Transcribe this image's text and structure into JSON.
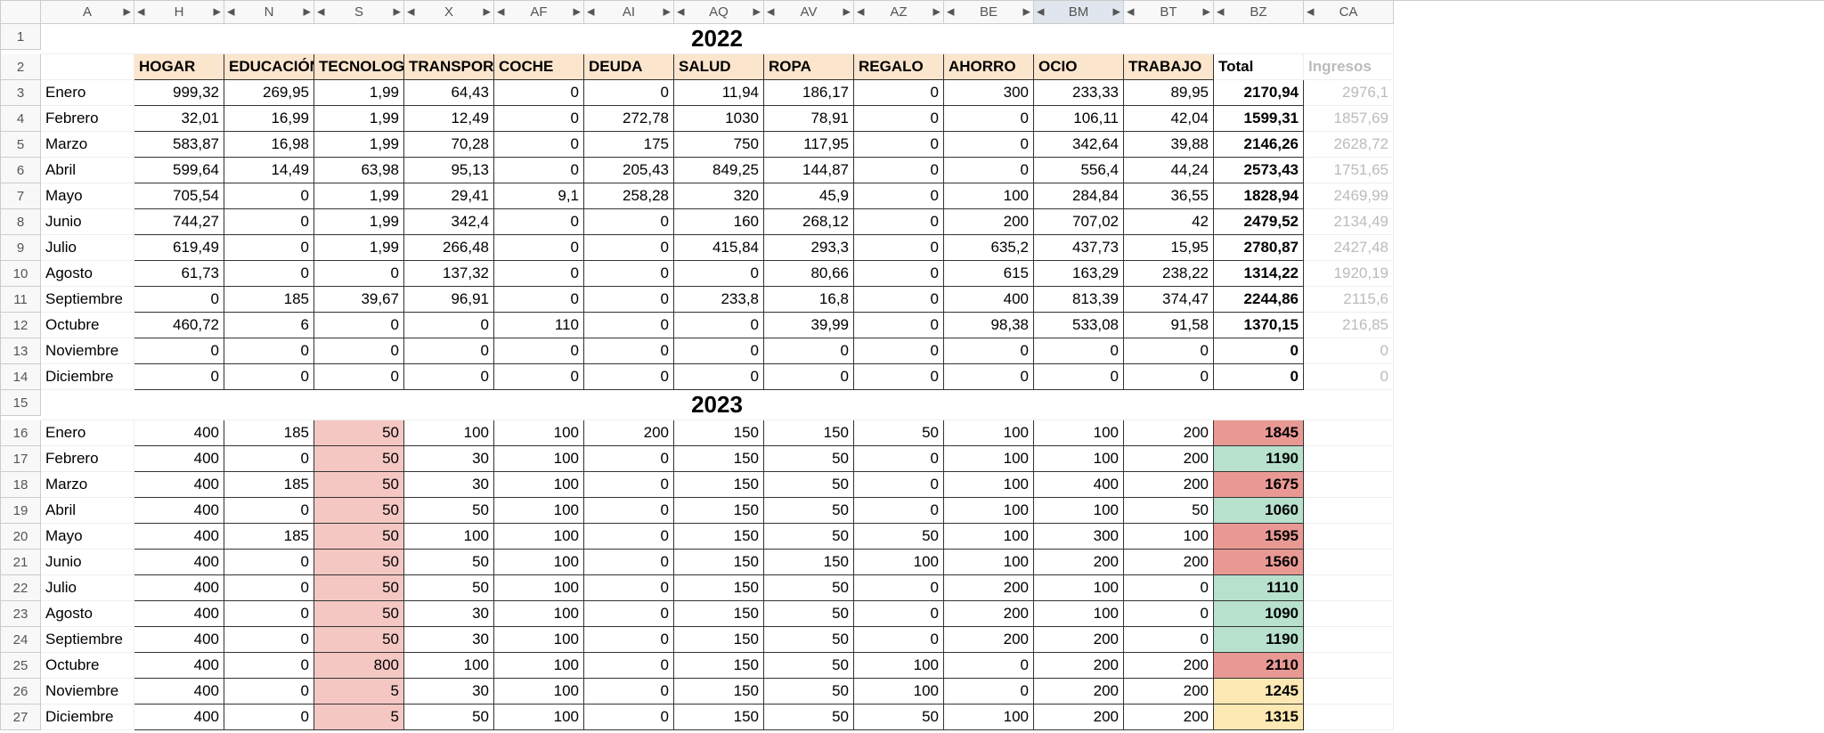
{
  "columns": [
    "A",
    "H",
    "N",
    "S",
    "X",
    "AF",
    "AI",
    "AQ",
    "AV",
    "AZ",
    "BE",
    "BM",
    "BT",
    "BZ",
    "CA"
  ],
  "selected_col": "BM",
  "row_numbers": [
    "1",
    "2",
    "3",
    "4",
    "5",
    "6",
    "7",
    "8",
    "9",
    "10",
    "11",
    "12",
    "13",
    "14",
    "15",
    "16",
    "17",
    "18",
    "19",
    "20",
    "21",
    "22",
    "23",
    "24",
    "25",
    "26",
    "27"
  ],
  "year_2022": "2022",
  "year_2023": "2023",
  "headers": {
    "hogar": "HOGAR",
    "educacion": "EDUCACIÓN",
    "tecnologia": "TECNOLOGÍA",
    "transporte": "TRANSPORTE",
    "coche": "COCHE",
    "deuda": "DEUDA",
    "salud": "SALUD",
    "ropa": "ROPA",
    "regalo": "REGALO",
    "ahorro": "AHORRO",
    "ocio": "OCIO",
    "trabajo": "TRABAJO",
    "total": "Total",
    "ingresos": "Ingresos"
  },
  "data2022": [
    {
      "m": "Enero",
      "v": [
        "999,32",
        "269,95",
        "1,99",
        "64,43",
        "0",
        "0",
        "11,94",
        "186,17",
        "0",
        "300",
        "233,33",
        "89,95"
      ],
      "t": "2170,94",
      "i": "2976,1"
    },
    {
      "m": "Febrero",
      "v": [
        "32,01",
        "16,99",
        "1,99",
        "12,49",
        "0",
        "272,78",
        "1030",
        "78,91",
        "0",
        "0",
        "106,11",
        "42,04"
      ],
      "t": "1599,31",
      "i": "1857,69"
    },
    {
      "m": "Marzo",
      "v": [
        "583,87",
        "16,98",
        "1,99",
        "70,28",
        "0",
        "175",
        "750",
        "117,95",
        "0",
        "0",
        "342,64",
        "39,88"
      ],
      "t": "2146,26",
      "i": "2628,72"
    },
    {
      "m": "Abril",
      "v": [
        "599,64",
        "14,49",
        "63,98",
        "95,13",
        "0",
        "205,43",
        "849,25",
        "144,87",
        "0",
        "0",
        "556,4",
        "44,24"
      ],
      "t": "2573,43",
      "i": "1751,65"
    },
    {
      "m": "Mayo",
      "v": [
        "705,54",
        "0",
        "1,99",
        "29,41",
        "9,1",
        "258,28",
        "320",
        "45,9",
        "0",
        "100",
        "284,84",
        "36,55"
      ],
      "t": "1828,94",
      "i": "2469,99"
    },
    {
      "m": "Junio",
      "v": [
        "744,27",
        "0",
        "1,99",
        "342,4",
        "0",
        "0",
        "160",
        "268,12",
        "0",
        "200",
        "707,02",
        "42"
      ],
      "t": "2479,52",
      "i": "2134,49"
    },
    {
      "m": "Julio",
      "v": [
        "619,49",
        "0",
        "1,99",
        "266,48",
        "0",
        "0",
        "415,84",
        "293,3",
        "0",
        "635,2",
        "437,73",
        "15,95"
      ],
      "t": "2780,87",
      "i": "2427,48"
    },
    {
      "m": "Agosto",
      "v": [
        "61,73",
        "0",
        "0",
        "137,32",
        "0",
        "0",
        "0",
        "80,66",
        "0",
        "615",
        "163,29",
        "238,22"
      ],
      "t": "1314,22",
      "i": "1920,19"
    },
    {
      "m": "Septiembre",
      "v": [
        "0",
        "185",
        "39,67",
        "96,91",
        "0",
        "0",
        "233,8",
        "16,8",
        "0",
        "400",
        "813,39",
        "374,47"
      ],
      "t": "2244,86",
      "i": "2115,6"
    },
    {
      "m": "Octubre",
      "v": [
        "460,72",
        "6",
        "0",
        "0",
        "110",
        "0",
        "0",
        "39,99",
        "0",
        "98,38",
        "533,08",
        "91,58"
      ],
      "t": "1370,15",
      "i": "216,85"
    },
    {
      "m": "Noviembre",
      "v": [
        "0",
        "0",
        "0",
        "0",
        "0",
        "0",
        "0",
        "0",
        "0",
        "0",
        "0",
        "0"
      ],
      "t": "0",
      "i": "0"
    },
    {
      "m": "Diciembre",
      "v": [
        "0",
        "0",
        "0",
        "0",
        "0",
        "0",
        "0",
        "0",
        "0",
        "0",
        "0",
        "0"
      ],
      "t": "0",
      "i": "0"
    }
  ],
  "data2023": [
    {
      "m": "Enero",
      "v": [
        "400",
        "185",
        "50",
        "100",
        "100",
        "200",
        "150",
        "150",
        "50",
        "100",
        "100",
        "200"
      ],
      "t": "1845",
      "tc": "red"
    },
    {
      "m": "Febrero",
      "v": [
        "400",
        "0",
        "50",
        "30",
        "100",
        "0",
        "150",
        "50",
        "0",
        "100",
        "100",
        "200"
      ],
      "t": "1190",
      "tc": "green"
    },
    {
      "m": "Marzo",
      "v": [
        "400",
        "185",
        "50",
        "30",
        "100",
        "0",
        "150",
        "50",
        "0",
        "100",
        "400",
        "200"
      ],
      "t": "1675",
      "tc": "red"
    },
    {
      "m": "Abril",
      "v": [
        "400",
        "0",
        "50",
        "50",
        "100",
        "0",
        "150",
        "50",
        "0",
        "100",
        "100",
        "50"
      ],
      "t": "1060",
      "tc": "green"
    },
    {
      "m": "Mayo",
      "v": [
        "400",
        "185",
        "50",
        "100",
        "100",
        "0",
        "150",
        "50",
        "50",
        "100",
        "300",
        "100"
      ],
      "t": "1595",
      "tc": "red"
    },
    {
      "m": "Junio",
      "v": [
        "400",
        "0",
        "50",
        "50",
        "100",
        "0",
        "150",
        "150",
        "100",
        "100",
        "200",
        "200"
      ],
      "t": "1560",
      "tc": "red"
    },
    {
      "m": "Julio",
      "v": [
        "400",
        "0",
        "50",
        "50",
        "100",
        "0",
        "150",
        "50",
        "0",
        "200",
        "100",
        "0"
      ],
      "t": "1110",
      "tc": "green"
    },
    {
      "m": "Agosto",
      "v": [
        "400",
        "0",
        "50",
        "30",
        "100",
        "0",
        "150",
        "50",
        "0",
        "200",
        "100",
        "0"
      ],
      "t": "1090",
      "tc": "green"
    },
    {
      "m": "Septiembre",
      "v": [
        "400",
        "0",
        "50",
        "30",
        "100",
        "0",
        "150",
        "50",
        "0",
        "200",
        "200",
        "0"
      ],
      "t": "1190",
      "tc": "green"
    },
    {
      "m": "Octubre",
      "v": [
        "400",
        "0",
        "800",
        "100",
        "100",
        "0",
        "150",
        "50",
        "100",
        "0",
        "200",
        "200"
      ],
      "t": "2110",
      "tc": "red"
    },
    {
      "m": "Noviembre",
      "v": [
        "400",
        "0",
        "5",
        "30",
        "100",
        "0",
        "150",
        "50",
        "100",
        "0",
        "200",
        "200"
      ],
      "t": "1245",
      "tc": "yellow"
    },
    {
      "m": "Diciembre",
      "v": [
        "400",
        "0",
        "5",
        "50",
        "100",
        "0",
        "150",
        "50",
        "50",
        "100",
        "200",
        "200"
      ],
      "t": "1315",
      "tc": "yellow"
    }
  ]
}
